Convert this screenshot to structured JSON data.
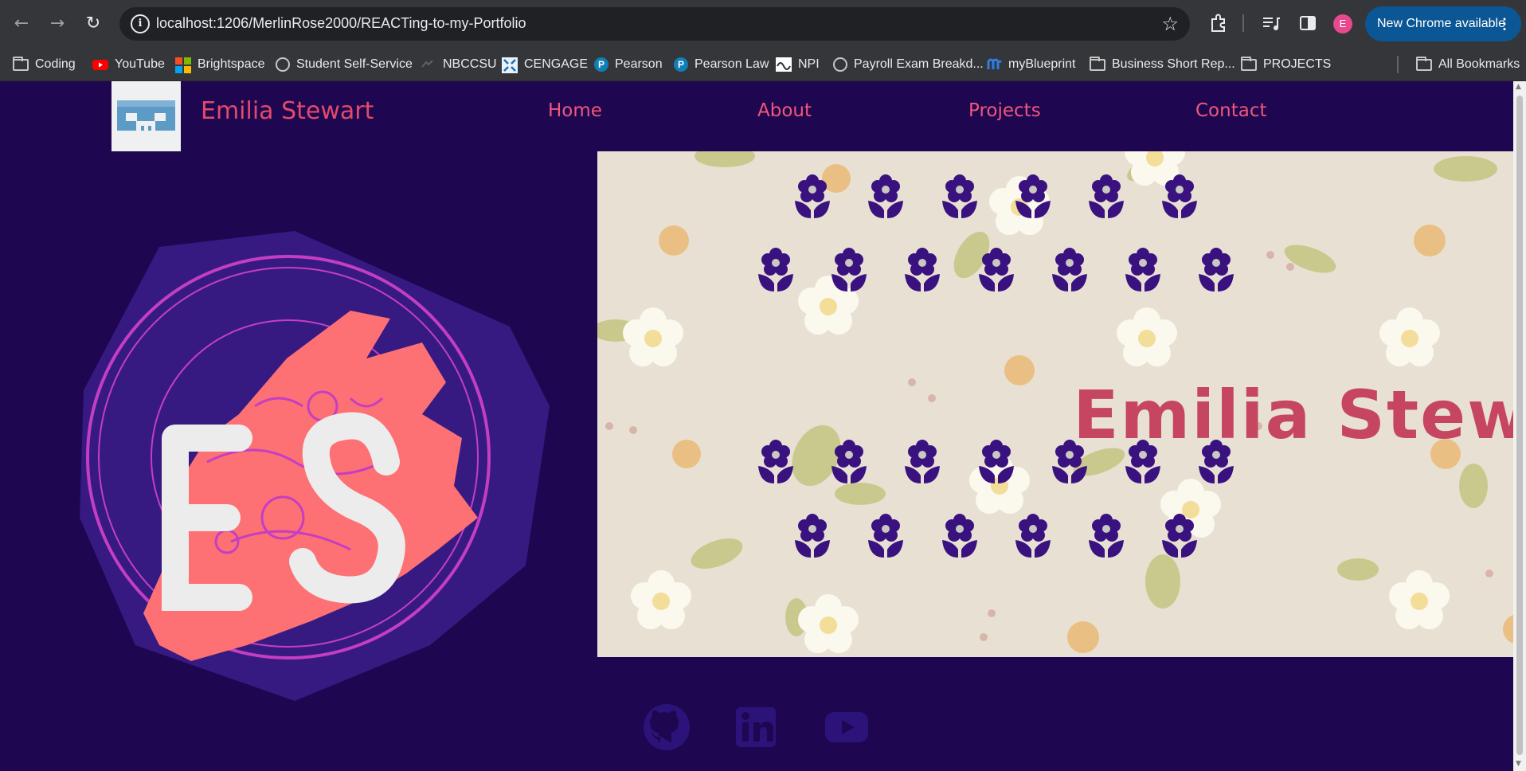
{
  "browser": {
    "url": "localhost:1206/MerlinRose2000/REACTing-to-my-Portfolio",
    "update_label": "New Chrome available",
    "profile_initial": "E",
    "bookmarks": [
      {
        "label": "Coding",
        "icon": "folder-icon"
      },
      {
        "label": "YouTube",
        "icon": "youtube-icon"
      },
      {
        "label": "Brightspace",
        "icon": "microsoft-icon"
      },
      {
        "label": "Student Self-Service",
        "icon": "globe-icon"
      },
      {
        "label": "NBCCSU",
        "icon": "nbccsu-icon"
      },
      {
        "label": "CENGAGE",
        "icon": "cengage-icon"
      },
      {
        "label": "Pearson",
        "icon": "pearson-icon"
      },
      {
        "label": "Pearson Law",
        "icon": "pearson-icon"
      },
      {
        "label": "NPI",
        "icon": "npi-icon"
      },
      {
        "label": "Payroll Exam Breakd...",
        "icon": "globe-icon"
      },
      {
        "label": "myBlueprint",
        "icon": "myblueprint-icon"
      },
      {
        "label": "Business Short Rep...",
        "icon": "folder-icon"
      },
      {
        "label": "PROJECTS",
        "icon": "folder-icon"
      }
    ],
    "all_bookmarks": "All Bookmarks"
  },
  "site": {
    "brand_name": "Emilia Stewart",
    "logo_initials": "ES",
    "nav": [
      {
        "label": "Home"
      },
      {
        "label": "About"
      },
      {
        "label": "Projects"
      },
      {
        "label": "Contact"
      }
    ],
    "hero_title": "Emilia Stewart",
    "social": [
      {
        "name": "github-icon"
      },
      {
        "name": "linkedin-icon"
      },
      {
        "name": "youtube-icon"
      }
    ]
  },
  "colors": {
    "page_bg": "#1e0750",
    "accent_pink": "#f0577a",
    "hero_title": "#c64560",
    "flower_purple": "#3a1280",
    "update_button": "#0b5694"
  }
}
